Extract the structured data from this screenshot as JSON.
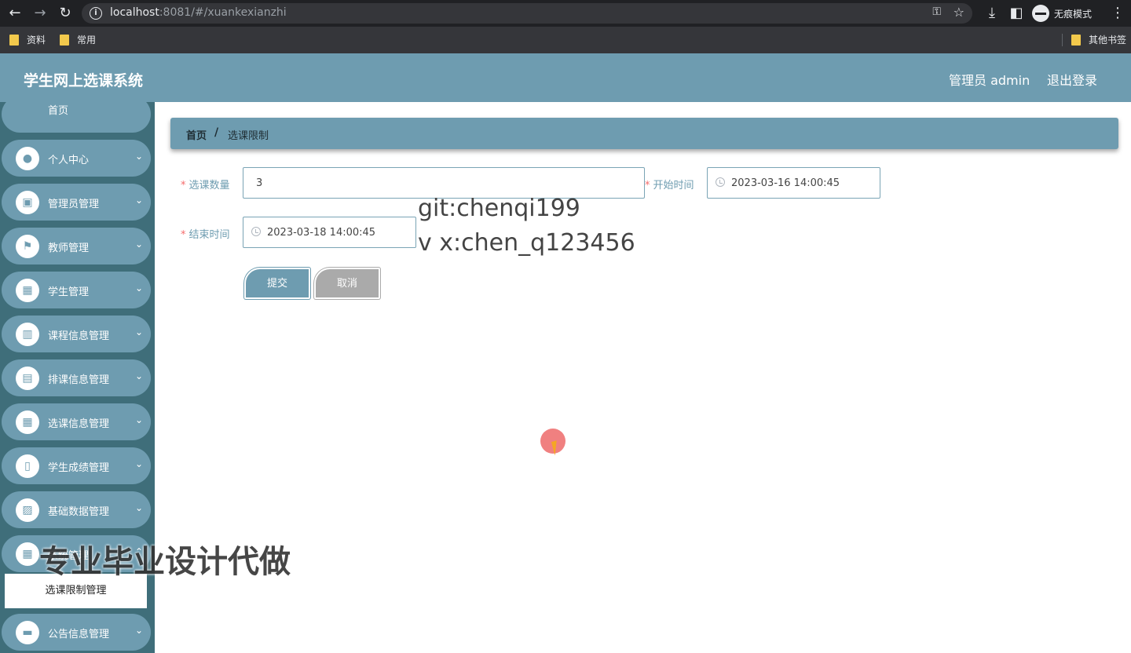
{
  "browser": {
    "url_host": "localhost",
    "url_rest": ":8081/#/xuankexianzhi",
    "incognito_label": "无痕模式",
    "bookmarks": [
      "资料",
      "常用"
    ],
    "other_bookmarks": "其他书签"
  },
  "header": {
    "title": "学生网上选课系统",
    "admin_label": "管理员 admin",
    "logout_label": "退出登录",
    "accent_color": "#6e9cb0"
  },
  "sidebar": {
    "home_label": "首页",
    "items": [
      {
        "label": "个人中心",
        "icon": "user-icon"
      },
      {
        "label": "管理员管理",
        "icon": "briefcase-icon"
      },
      {
        "label": "教师管理",
        "icon": "flag-icon"
      },
      {
        "label": "学生管理",
        "icon": "grid-icon"
      },
      {
        "label": "课程信息管理",
        "icon": "book-icon"
      },
      {
        "label": "排课信息管理",
        "icon": "inbox-icon"
      },
      {
        "label": "选课信息管理",
        "icon": "grid-icon"
      },
      {
        "label": "学生成绩管理",
        "icon": "clipboard-icon"
      },
      {
        "label": "基础数据管理",
        "icon": "chart-icon"
      },
      {
        "label": "系统管理",
        "icon": "grid-icon"
      },
      {
        "label": "公告信息管理",
        "icon": "message-icon"
      }
    ],
    "active_submenu": "选课限制管理"
  },
  "breadcrumb": {
    "home": "首页",
    "separator": "/",
    "current": "选课限制"
  },
  "form": {
    "quantity_label": "选课数量",
    "quantity_value": "3",
    "start_label": "开始时间",
    "start_value": "2023-03-16 14:00:45",
    "end_label": "结束时间",
    "end_value": "2023-03-18 14:00:45",
    "required_mark": "*",
    "submit_label": "提交",
    "cancel_label": "取消"
  },
  "overlay": {
    "git_line": "git:chenqi199",
    "wx_line": "v x:chen_q123456",
    "promo": "专业毕业设计代做"
  }
}
